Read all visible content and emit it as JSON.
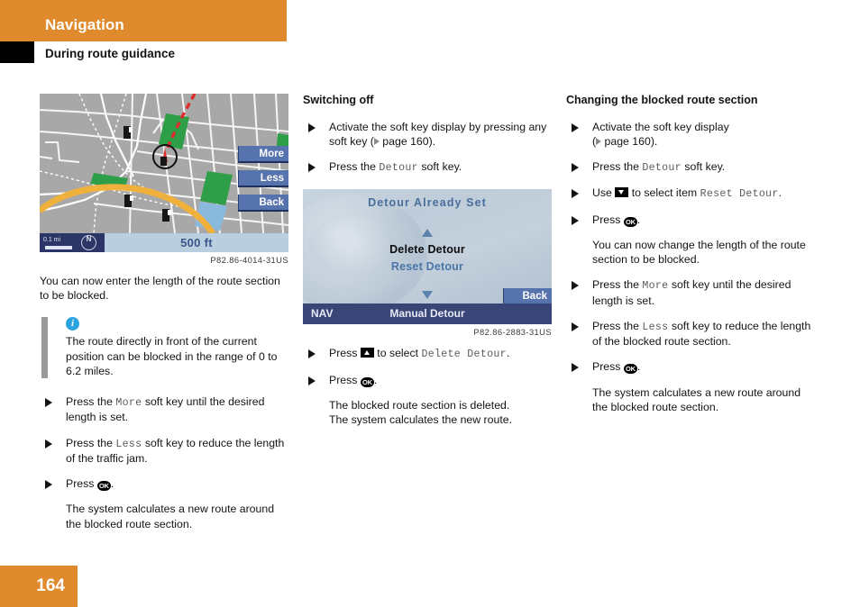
{
  "header": {
    "title": "Navigation",
    "subtitle": "During route guidance"
  },
  "figure_map": {
    "softkeys": [
      "More",
      "Less",
      "Back"
    ],
    "scale_label": "0.1 mi",
    "compass": "N",
    "distance": "500 ft",
    "caption": "P82.86-4014-31US"
  },
  "figure_screen": {
    "title": "Detour Already Set",
    "item_selected": "Delete Detour",
    "item_alt": "Reset Detour",
    "back_key": "Back",
    "nav_left": "NAV",
    "nav_center": "Manual Detour",
    "caption": "P82.86-2883-31US"
  },
  "column_left": {
    "intro": "You can now enter the length of the route section to be blocked.",
    "note": "The route directly in front of the current position can be blocked in the range of 0 to 6.2 miles.",
    "steps": [
      {
        "pre": "Press the ",
        "mono": "More",
        "post": " soft key until the desired length is set."
      },
      {
        "pre": "Press the ",
        "mono": "Less",
        "post": " soft key to reduce the length of the traffic jam."
      },
      {
        "pre": "Press ",
        "mono": "",
        "post": "."
      }
    ],
    "result": "The system calculates a new route around the blocked route section."
  },
  "column_middle": {
    "heading": "Switching off",
    "step1_a": "Activate the soft key display by pressing any soft key (",
    "step1_b": " page 160).",
    "step2_pre": "Press the ",
    "step2_mono": "Detour",
    "step2_post": " soft key.",
    "step3_pre": "Press ",
    "step3_mid": " to select ",
    "step3_mono": "Delete Detour",
    "step3_post": ".",
    "step4_pre": "Press ",
    "step4_post": ".",
    "result_l1": "The blocked route section is deleted.",
    "result_l2": "The system calculates the new route."
  },
  "column_right": {
    "heading": "Changing the blocked route section",
    "step1_a": "Activate the soft key display",
    "step1_b": " page 160).",
    "step2_pre": "Press the ",
    "step2_mono": "Detour",
    "step2_post": " soft key.",
    "step3_pre": "Use ",
    "step3_mid": " to select item ",
    "step3_mono": "Reset Detour",
    "step3_post": ".",
    "step4_pre": "Press ",
    "step4_post": ".",
    "note": "You can now change the length of the route section to be blocked.",
    "step5_pre": "Press the ",
    "step5_mono": "More",
    "step5_post": " soft key until the desired length is set.",
    "step6_pre": "Press the ",
    "step6_mono": "Less",
    "step6_post": " soft key to reduce the length of the blocked route section.",
    "step7_pre": "Press ",
    "step7_post": ".",
    "result": "The system calculates a new route around the blocked route section."
  },
  "footer": {
    "page_number": "164"
  },
  "colors": {
    "brand_orange": "#e08a2e",
    "softkey_blue": "#5773ae",
    "nav_bar_blue": "#3a4577",
    "map_gray": "#a8a8a8",
    "route_orange": "#f0b13c",
    "info_blue": "#2aa3e0"
  }
}
